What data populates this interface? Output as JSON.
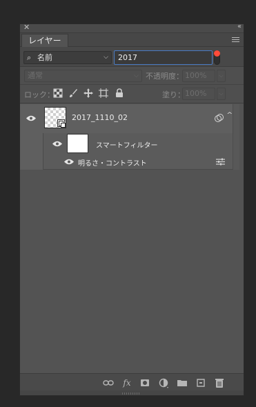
{
  "panel": {
    "tab_label": "レイヤー"
  },
  "filter": {
    "kind_label": "名前",
    "search_value": "2017",
    "toggle_color": "#ff4b3a"
  },
  "blend": {
    "mode": "通常",
    "opacity_label": "不透明度：",
    "opacity_value": "100%"
  },
  "lock": {
    "label": "ロック：",
    "fill_label": "塗り：",
    "fill_value": "100%"
  },
  "layers": [
    {
      "name": "2017_1110_02",
      "type": "smart-object",
      "visible": true
    },
    {
      "name": "スマートフィルター",
      "type": "smart-filter",
      "visible": true
    },
    {
      "name": "明るさ・コントラスト",
      "type": "filter",
      "visible": true
    }
  ],
  "bottom_tools": [
    "link-icon",
    "fx-icon",
    "mask-icon",
    "adjustment-icon",
    "folder-icon",
    "new-layer-icon",
    "trash-icon"
  ],
  "colors": {
    "accent": "#4a7cc4",
    "panel_bg": "#535353",
    "app_bg": "#282828"
  }
}
